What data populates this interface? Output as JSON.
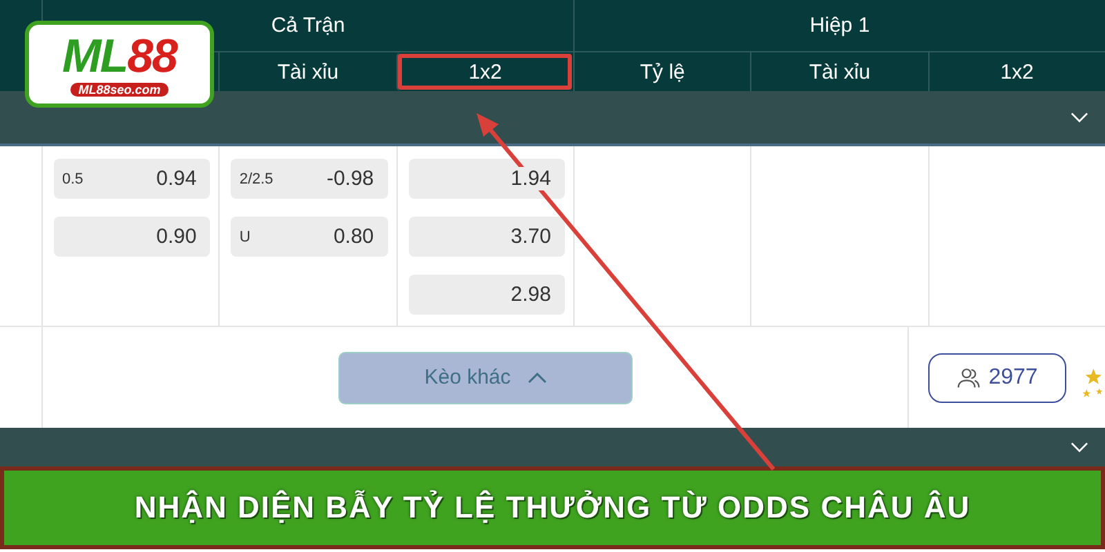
{
  "logo": {
    "part_1": "ML",
    "part_2": "88",
    "site": "ML88seo.com"
  },
  "header": {
    "groups": [
      {
        "title": "Cả Trận",
        "columns": [
          {
            "label": "Tài xỉu",
            "highlighted": false
          },
          {
            "label": "1x2",
            "highlighted": true
          }
        ]
      },
      {
        "title": "Hiệp 1",
        "columns": [
          {
            "label": "Tỷ lệ",
            "highlighted": false
          },
          {
            "label": "Tài xỉu",
            "highlighted": false
          },
          {
            "label": "1x2",
            "highlighted": false
          }
        ]
      }
    ]
  },
  "odds_columns": [
    [
      {
        "line": "0.5",
        "odd": "0.94"
      },
      {
        "odd": "0.90"
      }
    ],
    [
      {
        "line": "2/2.5",
        "odd": "-0.98"
      },
      {
        "line": "U",
        "odd": "0.80"
      }
    ],
    [
      {
        "odd": "1.94"
      },
      {
        "odd": "3.70"
      },
      {
        "odd": "2.98"
      }
    ]
  ],
  "more_button": {
    "label": "Kèo khác"
  },
  "viewers": {
    "count": "2977"
  },
  "banner": {
    "text": "NHẬN DIỆN BẪY TỶ LỆ THƯỞNG TỪ ODDS CHÂU ÂU"
  }
}
